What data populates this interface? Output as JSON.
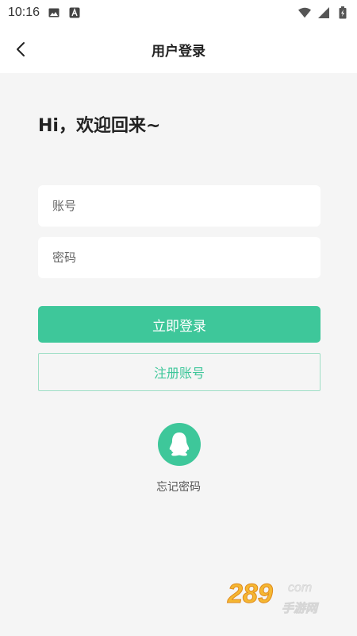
{
  "status_bar": {
    "time": "10:16"
  },
  "nav": {
    "title": "用户登录"
  },
  "main": {
    "greeting": "Hi，欢迎回来~",
    "account_placeholder": "账号",
    "password_placeholder": "密码",
    "login_label": "立即登录",
    "register_label": "注册账号",
    "forgot_label": "忘记密码"
  },
  "watermark": {
    "logo_text": "289",
    "logo_suffix": "com",
    "logo_sub": "手游网"
  },
  "colors": {
    "accent": "#3ec79a",
    "accent_border": "#9fdfc6",
    "background": "#f5f5f5"
  },
  "icons": [
    "image-icon",
    "a-icon",
    "wifi-icon",
    "signal-icon",
    "battery-icon",
    "back-icon",
    "qq-icon"
  ]
}
